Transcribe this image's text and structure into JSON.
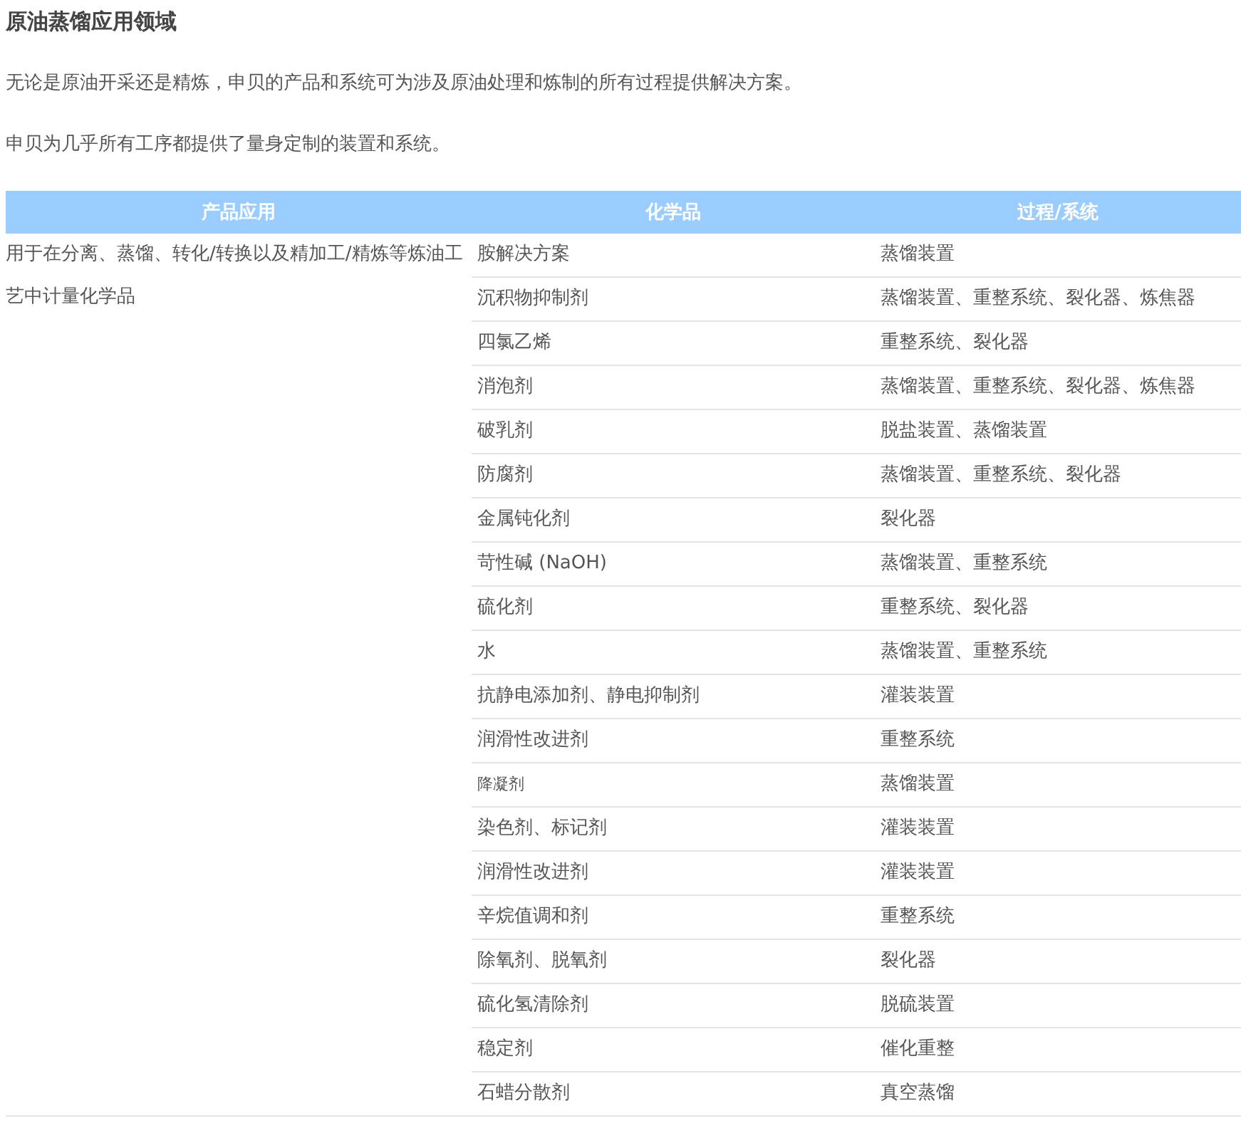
{
  "title": "原油蒸馏应用领域",
  "paragraphs": [
    "无论是原油开采还是精炼，申贝的产品和系统可为涉及原油处理和炼制的所有过程提供解决方案。",
    "申贝为几乎所有工序都提供了量身定制的装置和系统。"
  ],
  "table": {
    "columns": [
      "产品应用",
      "化学品",
      "过程/系统"
    ],
    "application": "用于在分离、蒸馏、转化/转换以及精加工/精炼等炼油工艺中计量化学品",
    "rows": [
      {
        "chemical": "胺解决方案",
        "process": "蒸馏装置",
        "small": false
      },
      {
        "chemical": "沉积物抑制剂",
        "process": "蒸馏装置、重整系统、裂化器、炼焦器",
        "small": false
      },
      {
        "chemical": "四氯乙烯",
        "process": "重整系统、裂化器",
        "small": false
      },
      {
        "chemical": "消泡剂",
        "process": "蒸馏装置、重整系统、裂化器、炼焦器",
        "small": false
      },
      {
        "chemical": "破乳剂",
        "process": "脱盐装置、蒸馏装置",
        "small": false
      },
      {
        "chemical": "防腐剂",
        "process": "蒸馏装置、重整系统、裂化器",
        "small": false
      },
      {
        "chemical": "金属钝化剂",
        "process": "裂化器",
        "small": false
      },
      {
        "chemical": "苛性碱 (NaOH)",
        "process": "蒸馏装置、重整系统",
        "small": false
      },
      {
        "chemical": "硫化剂",
        "process": "重整系统、裂化器",
        "small": false
      },
      {
        "chemical": "水",
        "process": "蒸馏装置、重整系统",
        "small": false
      },
      {
        "chemical": "抗静电添加剂、静电抑制剂",
        "process": "灌装装置",
        "small": false
      },
      {
        "chemical": "润滑性改进剂",
        "process": "重整系统",
        "small": false
      },
      {
        "chemical": "降凝剂",
        "process": "蒸馏装置",
        "small": true
      },
      {
        "chemical": "染色剂、标记剂",
        "process": "灌装装置",
        "small": false
      },
      {
        "chemical": "润滑性改进剂",
        "process": "灌装装置",
        "small": false
      },
      {
        "chemical": "辛烷值调和剂",
        "process": "重整系统",
        "small": false
      },
      {
        "chemical": "除氧剂、脱氧剂",
        "process": "裂化器",
        "small": false
      },
      {
        "chemical": "硫化氢清除剂",
        "process": "脱硫装置",
        "small": false
      },
      {
        "chemical": "稳定剂",
        "process": "催化重整",
        "small": false
      },
      {
        "chemical": "石蜡分散剂",
        "process": "真空蒸馏",
        "small": false
      }
    ]
  }
}
